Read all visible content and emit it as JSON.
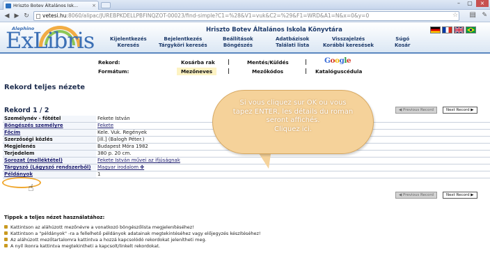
{
  "browser": {
    "tab_title": "Hriszto Botev Általános Isk...",
    "tab_close": "×",
    "url_host": "vetesi.hu",
    "url_path": ":8060/alipac/JUREBPKDELLPBFINQZOT-00023/find-simple?C1=%28&V1=vuk&C2=%29&F1=WRD&A1=N&x=0&y=0",
    "window_controls": [
      "–",
      "▢",
      "×"
    ]
  },
  "header": {
    "logo_alephino": "Alephino",
    "logo_text": "ExLibris",
    "site_title": "Hriszto Botev Általános Iskola Könyvtára",
    "menu": [
      {
        "top": "Kijelentkezés",
        "bottom": "Keresés"
      },
      {
        "top": "Bejelentkezés",
        "bottom": "Tárgyköri keresés"
      },
      {
        "top": "Beállítások",
        "bottom": "Böngészés"
      },
      {
        "top": "Adatbázisok",
        "bottom": "Találati lista"
      },
      {
        "top": "Visszajelzés",
        "bottom": "Korábbi keresések"
      },
      {
        "top": "Súgó",
        "bottom": "Kosár"
      }
    ],
    "flags": [
      "de-flag-icon",
      "fr-flag-icon",
      "uk-flag-icon",
      "br-flag-icon"
    ]
  },
  "record_panel": {
    "rekord_label": "Rekord:",
    "format_label": "Formátum:",
    "kosarba": "Kosárba rak",
    "mentes": "Mentés/Küldés",
    "mezoneves": "Mezőneves",
    "mezokodos": "Mezőkódos",
    "katalogus": "Katalóguscédula",
    "google": [
      "G",
      "o",
      "o",
      "g",
      "l",
      "e"
    ]
  },
  "main": {
    "page_title": "Rekord teljes nézete",
    "record_counter": "Rekord 1 / 2",
    "prev_record": "◀ Previous Record",
    "next_record": "Next Record ▶",
    "rows": [
      {
        "key": "Személynév - főtétel",
        "value": "Fekete István",
        "key_link": false,
        "value_link": false
      },
      {
        "key": "Böngészés személyre",
        "value": "Fekete",
        "key_link": true,
        "value_link": true
      },
      {
        "key": "Főcím",
        "value": "Kele. Vuk.  Regények",
        "key_link": true,
        "value_link": false
      },
      {
        "key": "Szerzőségi közlés",
        "value": "[ill.] (Balogh Péter.)",
        "key_link": false,
        "value_link": false
      },
      {
        "key": "Megjelenés",
        "value": "Budapest Móra 1982",
        "key_link": false,
        "value_link": false
      },
      {
        "key": "Terjedelem",
        "value": "380 p.  20 cm.",
        "key_link": false,
        "value_link": false
      },
      {
        "key": "Sorozat (melléktétel)",
        "value": "Fekete István művei az ifjúságnak",
        "key_link": true,
        "value_link": true
      },
      {
        "key": "Tárgyszó (Lágyszó rendszerből)",
        "value": "Magyar irodalom ✤",
        "key_link": true,
        "value_link": true
      },
      {
        "key": "Példányok",
        "value": "1",
        "key_link": true,
        "value_link": false
      }
    ]
  },
  "callout": {
    "lines": [
      "Si vous cliquez sur OK ou vous",
      "tapez ENTER, les détails du roman",
      "seront affichés.",
      "Cliquez ici."
    ]
  },
  "tips": {
    "title": "Tippek a teljes nézet használatához:",
    "items": [
      "Kattintson az aláhúzott mezőnévre a vonatkozó böngészőlista megjelenítéséhez!",
      "Kattintson a \"példányok\" -ra a fellelhető példányok adatainak megtekintéséhez vagy előjegyzés készítéséhez!",
      "Az aláhúzott mezőtartalomra kattintva a hozzá kapcsolódó rekordokat jelenítheti meg.",
      "A nyíl ikonra kattintva megtekintheti a kapcsolt/linkelt rekordokat."
    ]
  },
  "colors": {
    "accent": "#5b87c0",
    "callout_fill": "#f5d29a",
    "highlight_circle": "#f0a830"
  }
}
